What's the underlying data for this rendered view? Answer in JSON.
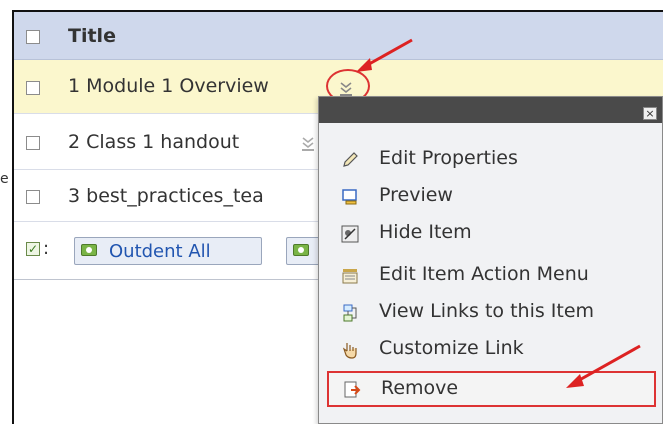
{
  "table": {
    "header": {
      "title": "Title"
    },
    "rows": [
      {
        "text": "1 Module 1 Overview"
      },
      {
        "text": "2 Class 1 handout"
      },
      {
        "text": "3 best_practices_tea"
      }
    ],
    "footer": {
      "colon": ":",
      "outdent_label": "Outdent All"
    }
  },
  "side_fragment": "e",
  "context_menu": {
    "close_glyph": "×",
    "items": [
      {
        "label": "Edit Properties",
        "icon": "pencil-icon"
      },
      {
        "label": "Preview",
        "icon": "preview-icon"
      },
      {
        "label": "Hide Item",
        "icon": "hide-icon"
      },
      {
        "label": "Edit Item Action Menu",
        "icon": "action-menu-icon"
      },
      {
        "label": "View Links to this Item",
        "icon": "links-icon"
      },
      {
        "label": "Customize Link",
        "icon": "hand-pointer-icon"
      },
      {
        "label": "Remove",
        "icon": "remove-icon"
      }
    ]
  },
  "colors": {
    "header_bg": "#cfd8ec",
    "highlight_row_bg": "#fbf7cd",
    "annotation_red": "#dd2222",
    "link_blue": "#2155b0"
  }
}
